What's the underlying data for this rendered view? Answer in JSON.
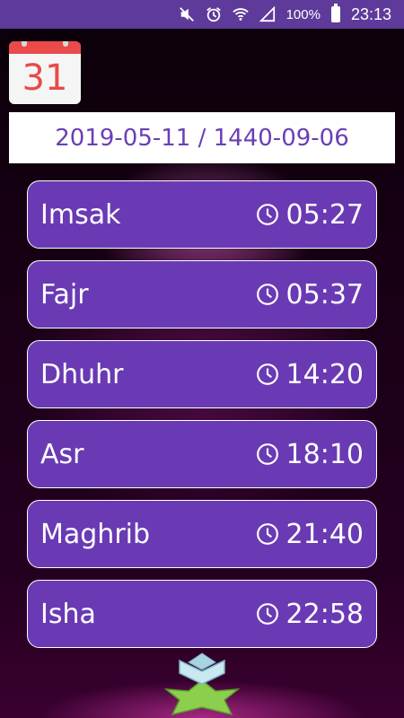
{
  "status_bar": {
    "battery_percent": "100%",
    "time": "23:13",
    "icons": [
      "mute-icon",
      "alarm-icon",
      "wifi-icon",
      "signal-icon",
      "battery-icon"
    ]
  },
  "calendar": {
    "day": "31"
  },
  "date_bar": {
    "text": "2019-05-11 / 1440-09-06"
  },
  "prayers": [
    {
      "name": "Imsak",
      "time": "05:27"
    },
    {
      "name": "Fajr",
      "time": "05:37"
    },
    {
      "name": "Dhuhr",
      "time": "14:20"
    },
    {
      "name": "Asr",
      "time": "18:10"
    },
    {
      "name": "Maghrib",
      "time": "21:40"
    },
    {
      "name": "Isha",
      "time": "22:58"
    }
  ],
  "colors": {
    "accent": "#6a3ab4",
    "status_bar": "#5e3b9a",
    "calendar_red": "#ea4a4a"
  }
}
